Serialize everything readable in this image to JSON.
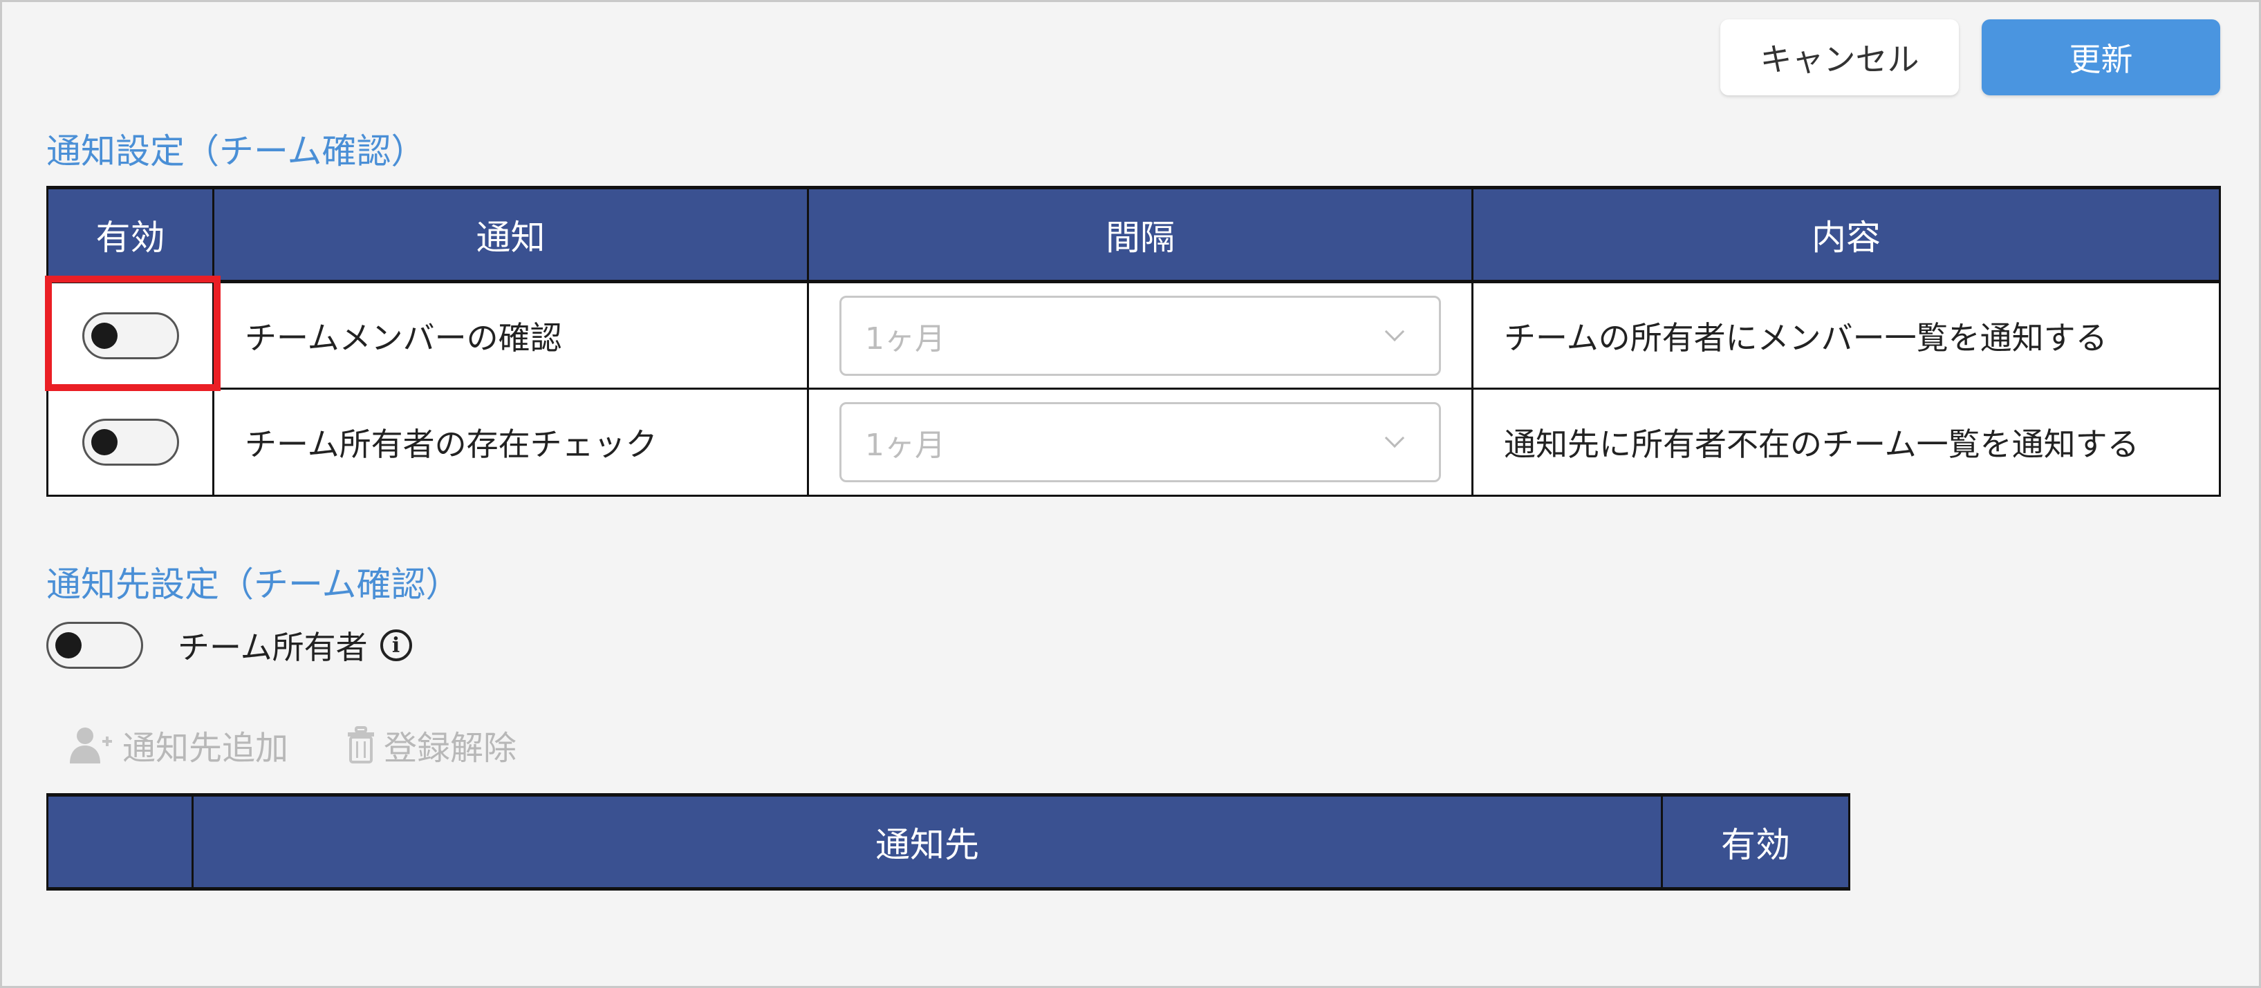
{
  "toolbar": {
    "cancel_label": "キャンセル",
    "update_label": "更新"
  },
  "notification_settings": {
    "title": "通知設定（チーム確認）",
    "columns": [
      "有効",
      "通知",
      "間隔",
      "内容"
    ],
    "rows": [
      {
        "enabled": false,
        "name": "チームメンバーの確認",
        "interval": "1ヶ月",
        "description": "チームの所有者にメンバー一覧を通知する"
      },
      {
        "enabled": false,
        "name": "チーム所有者の存在チェック",
        "interval": "1ヶ月",
        "description": "通知先に所有者不在のチーム一覧を通知する"
      }
    ]
  },
  "recipient_settings": {
    "title": "通知先設定（チーム確認）",
    "owner_toggle_enabled": false,
    "owner_label": "チーム所有者",
    "info_icon": "info-icon",
    "actions": {
      "add_label": "通知先追加",
      "add_icon": "user-plus-icon",
      "remove_label": "登録解除",
      "remove_icon": "trash-icon"
    },
    "columns": [
      "",
      "通知先",
      "有効"
    ]
  },
  "colors": {
    "header_bg": "#3a5191",
    "accent_blue": "#4a95e0",
    "title_blue": "#4a8fd6",
    "highlight_red": "#ea1f25",
    "disabled_text": "#b8b8b8"
  }
}
